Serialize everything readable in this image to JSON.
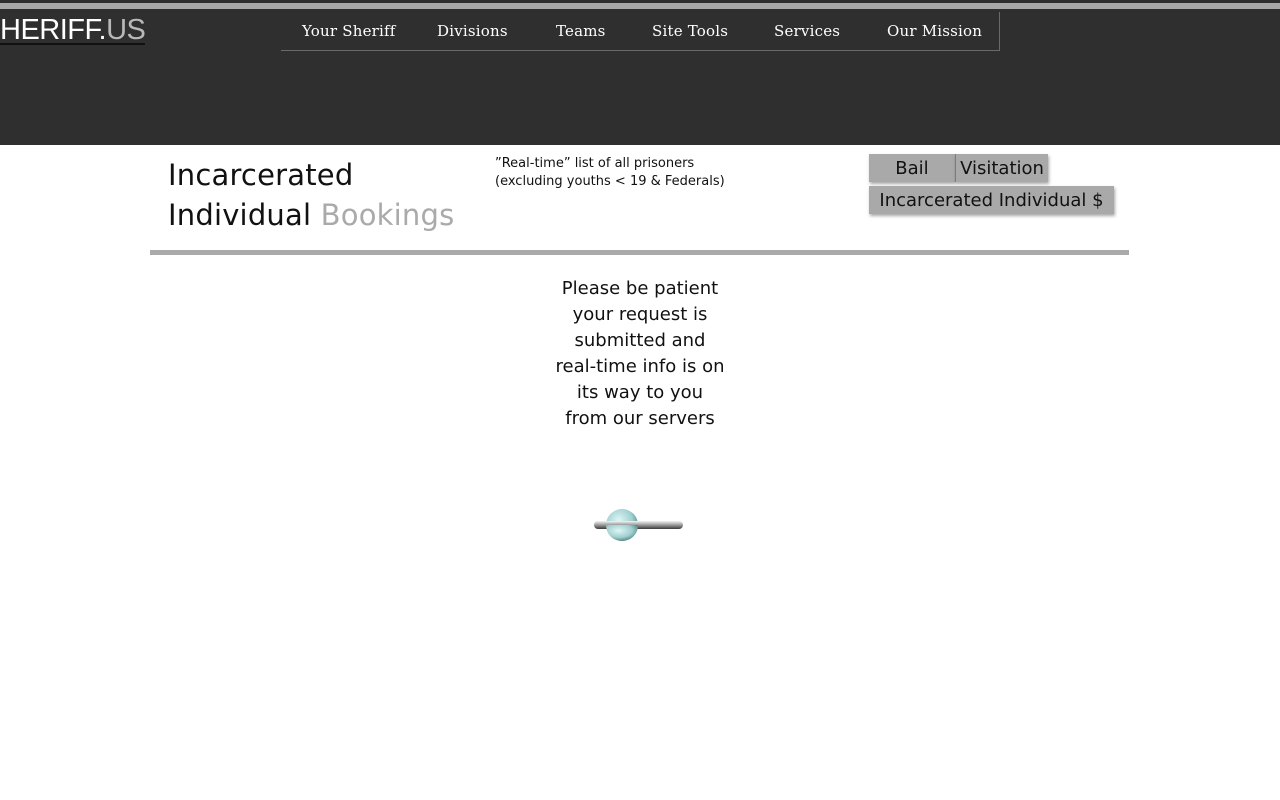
{
  "header": {
    "logo": {
      "main": "HERIFF",
      "separator": ".",
      "tld": "US"
    },
    "nav": [
      {
        "label": "Your Sheriff"
      },
      {
        "label": "Divisions"
      },
      {
        "label": "Teams"
      },
      {
        "label": "Site Tools"
      },
      {
        "label": "Services"
      },
      {
        "label": "Our Mission"
      }
    ]
  },
  "title": {
    "line1": "Incarcerated",
    "line2_main": "Individual",
    "line2_accent": "Bookings"
  },
  "subtitle": {
    "line1": "”Real-time” list of all prisoners",
    "line2": "(excluding youths <  19 & Federals)"
  },
  "buttons": {
    "bail": "Bail",
    "visitation": "Visitation",
    "funds": "Incarcerated Individual $"
  },
  "loading": {
    "lines": [
      "Please be patient",
      "your request is",
      "submitted and",
      "real-time info is on",
      "its way to you",
      "from our servers"
    ]
  },
  "colors": {
    "header_bg": "#2f2f2f",
    "accent_gray": "#aaaaaa",
    "button_bg": "#a9a9a9"
  },
  "icons": {
    "spinner": "loading-spinner-icon"
  }
}
